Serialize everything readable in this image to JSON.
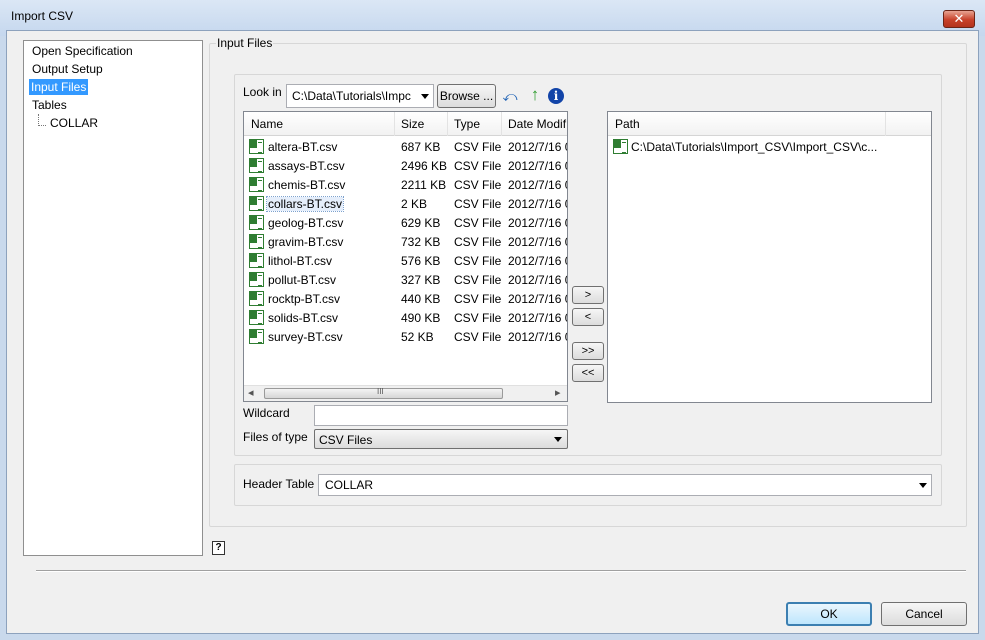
{
  "window": {
    "title": "Import CSV",
    "close_glyph": "✕"
  },
  "nav": {
    "items": [
      {
        "label": "Open Specification"
      },
      {
        "label": "Output Setup"
      },
      {
        "label": "Input Files"
      },
      {
        "label": "Tables"
      },
      {
        "label": "COLLAR"
      }
    ],
    "selected": "Input Files"
  },
  "input_files": {
    "group_title": "Input Files",
    "look_in_label": "Look in",
    "look_in_value": "C:\\Data\\Tutorials\\Impc",
    "browse_label": "Browse ...",
    "icons": [
      "undo-icon",
      "up-folder-icon",
      "info-icon"
    ],
    "columns": [
      "Name",
      "Size",
      "Type",
      "Date Modif"
    ],
    "files": [
      {
        "name": "altera-BT.csv",
        "size": "687 KB",
        "type": "CSV File",
        "date": "2012/7/16 0"
      },
      {
        "name": "assays-BT.csv",
        "size": "2496 KB",
        "type": "CSV File",
        "date": "2012/7/16 0"
      },
      {
        "name": "chemis-BT.csv",
        "size": "2211 KB",
        "type": "CSV File",
        "date": "2012/7/16 0"
      },
      {
        "name": "collars-BT.csv",
        "size": "2 KB",
        "type": "CSV File",
        "date": "2012/7/16 0"
      },
      {
        "name": "geolog-BT.csv",
        "size": "629 KB",
        "type": "CSV File",
        "date": "2012/7/16 0"
      },
      {
        "name": "gravim-BT.csv",
        "size": "732 KB",
        "type": "CSV File",
        "date": "2012/7/16 0"
      },
      {
        "name": "lithol-BT.csv",
        "size": "576 KB",
        "type": "CSV File",
        "date": "2012/7/16 0"
      },
      {
        "name": "pollut-BT.csv",
        "size": "327 KB",
        "type": "CSV File",
        "date": "2012/7/16 0"
      },
      {
        "name": "rocktp-BT.csv",
        "size": "440 KB",
        "type": "CSV File",
        "date": "2012/7/16 0"
      },
      {
        "name": "solids-BT.csv",
        "size": "490 KB",
        "type": "CSV File",
        "date": "2012/7/16 0"
      },
      {
        "name": "survey-BT.csv",
        "size": "52 KB",
        "type": "CSV File",
        "date": "2012/7/16 0"
      }
    ],
    "selected_file": "collars-BT.csv",
    "scroll_left_glyph": "◂",
    "scroll_right_glyph": "▸",
    "scroll_grip": "III",
    "wildcard_label": "Wildcard",
    "wildcard_value": "",
    "files_of_type_label": "Files of type",
    "files_of_type_value": "CSV Files",
    "move_buttons": [
      ">",
      "<",
      ">>",
      "<<"
    ],
    "path_column": "Path",
    "paths": [
      "C:\\Data\\Tutorials\\Import_CSV\\Import_CSV\\c..."
    ]
  },
  "header_table": {
    "label": "Header Table",
    "value": "COLLAR"
  },
  "footer": {
    "help_glyph": "?",
    "ok_label": "OK",
    "cancel_label": "Cancel"
  },
  "colors": {
    "selection": "#3399ff",
    "window_bg": "#f0f0f0",
    "ok_border": "#3c7fb1"
  }
}
